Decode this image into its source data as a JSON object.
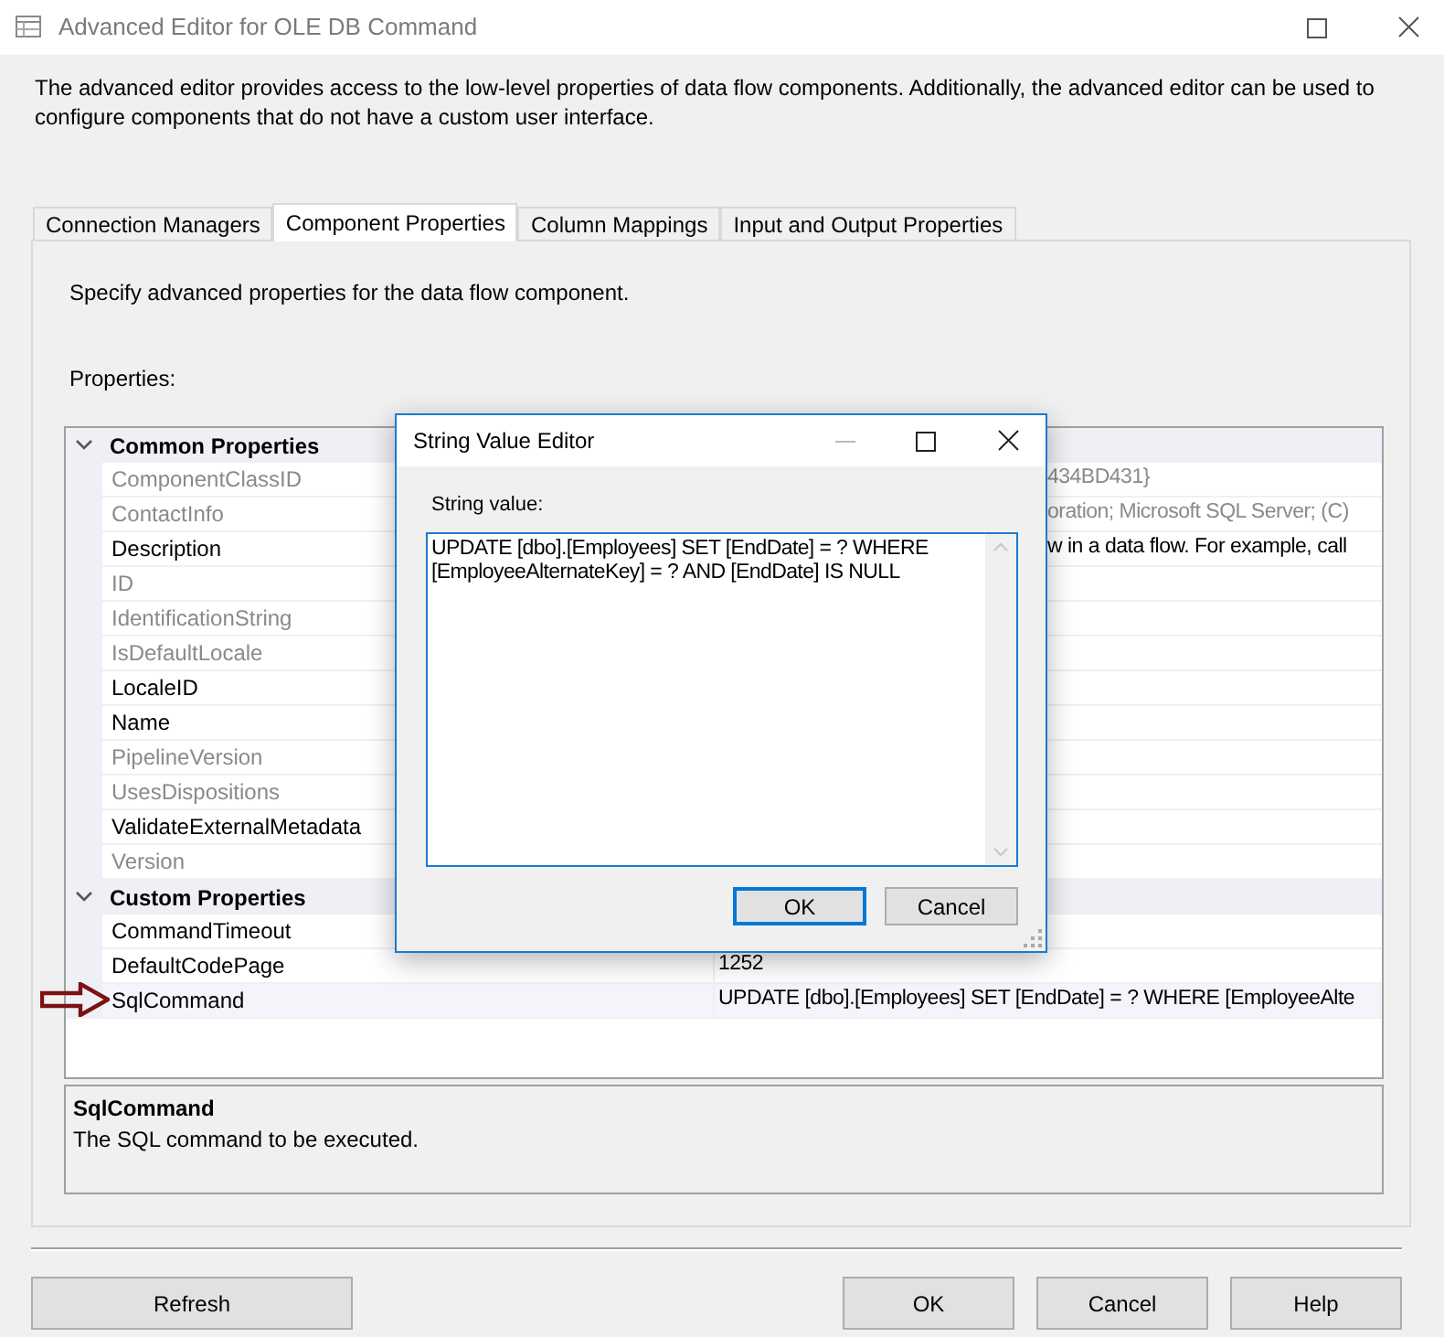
{
  "window": {
    "title": "Advanced Editor for OLE DB Command"
  },
  "intro": "The advanced editor provides access to the low-level properties of data flow components. Additionally, the advanced editor can be used to configure components that do not have a custom user interface.",
  "tabs": [
    {
      "label": "Connection Managers",
      "selected": false
    },
    {
      "label": "Component Properties",
      "selected": true
    },
    {
      "label": "Column Mappings",
      "selected": false
    },
    {
      "label": "Input and Output Properties",
      "selected": false
    }
  ],
  "panel": {
    "instruction": "Specify advanced properties for the data flow component.",
    "properties_label": "Properties:"
  },
  "property_grid": {
    "categories": [
      {
        "name": "Common Properties",
        "expanded": true,
        "properties": [
          {
            "name": "ComponentClassID",
            "readonly": true,
            "selected": false,
            "value": "434BD431}",
            "covered": true
          },
          {
            "name": "ContactInfo",
            "readonly": true,
            "selected": false,
            "value": "oration; Microsoft SQL Server; (C)",
            "covered": true
          },
          {
            "name": "Description",
            "readonly": false,
            "selected": false,
            "value": "w in a data flow. For example, call",
            "covered": true
          },
          {
            "name": "ID",
            "readonly": true,
            "selected": false
          },
          {
            "name": "IdentificationString",
            "readonly": true,
            "selected": false
          },
          {
            "name": "IsDefaultLocale",
            "readonly": true,
            "selected": false
          },
          {
            "name": "LocaleID",
            "readonly": false,
            "selected": false
          },
          {
            "name": "Name",
            "readonly": false,
            "selected": false
          },
          {
            "name": "PipelineVersion",
            "readonly": true,
            "selected": false
          },
          {
            "name": "UsesDispositions",
            "readonly": true,
            "selected": false
          },
          {
            "name": "ValidateExternalMetadata",
            "readonly": false,
            "selected": false
          },
          {
            "name": "Version",
            "readonly": true,
            "selected": false
          }
        ]
      },
      {
        "name": "Custom Properties",
        "expanded": true,
        "properties": [
          {
            "name": "CommandTimeout",
            "readonly": false,
            "selected": false
          },
          {
            "name": "DefaultCodePage",
            "readonly": false,
            "selected": false,
            "value": "1252",
            "covered": false
          },
          {
            "name": "SqlCommand",
            "readonly": false,
            "selected": true,
            "value": "UPDATE [dbo].[Employees] SET [EndDate] = ? WHERE [EmployeeAlte",
            "covered": false
          }
        ]
      }
    ]
  },
  "description_panel": {
    "title": "SqlCommand",
    "text": "The SQL command to be executed."
  },
  "buttons": [
    "Refresh",
    "OK",
    "Cancel",
    "Help"
  ],
  "string_editor": {
    "title": "String Value Editor",
    "label": "String value:",
    "value": "UPDATE [dbo].[Employees] SET [EndDate] = ? WHERE [EmployeeAlternateKey] = ? AND [EndDate] IS NULL",
    "buttons": [
      {
        "label": "OK",
        "default": true
      },
      {
        "label": "Cancel",
        "default": false
      }
    ]
  }
}
